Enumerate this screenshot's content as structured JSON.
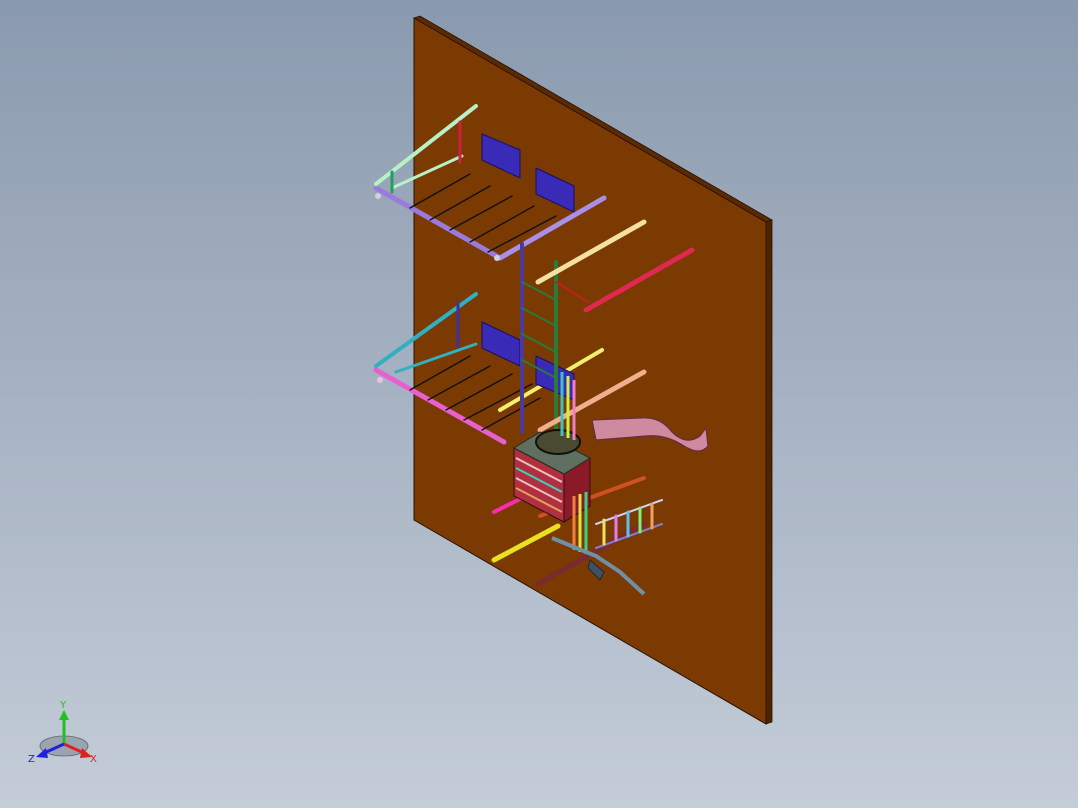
{
  "viewport": {
    "background_top": "#8a9aae",
    "background_bottom": "#c4ccd8"
  },
  "model": {
    "board_color": "#7a3a02",
    "board_edge_color": "#4d2400"
  },
  "triad": {
    "x_label": "X",
    "y_label": "Y",
    "z_label": "Z",
    "x_color": "#e02020",
    "y_color": "#20c020",
    "z_color": "#2020e0"
  }
}
